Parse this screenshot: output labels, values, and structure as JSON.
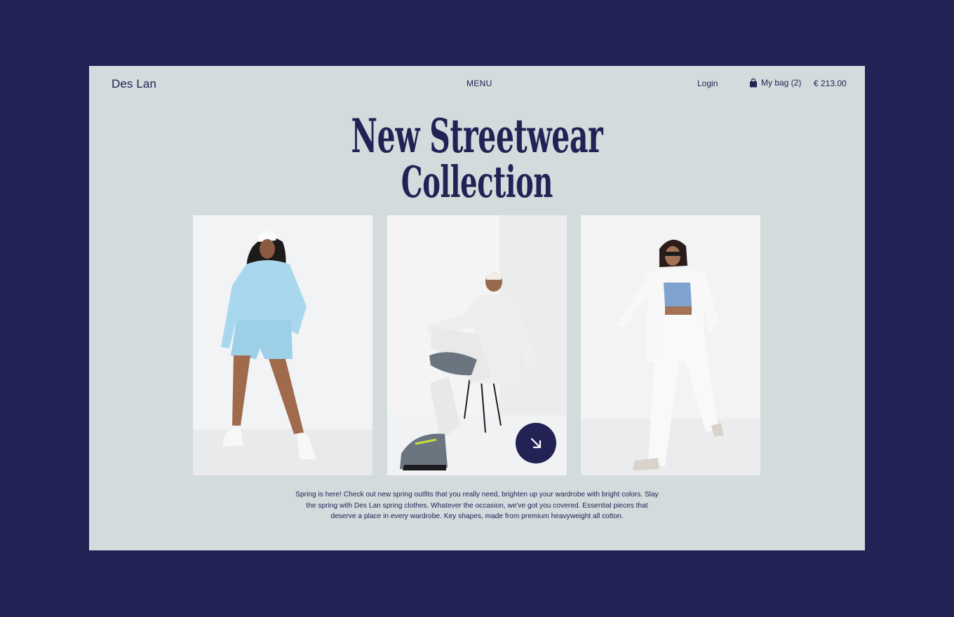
{
  "nav": {
    "brand": "Des Lan",
    "menu_label": "MENU",
    "login_label": "Login",
    "bag_label": "My bag (2)",
    "bag_total": "€ 213.00"
  },
  "hero": {
    "title_line1": "New Streetwear",
    "title_line2": "Collection"
  },
  "gallery": {
    "items": [
      {
        "outfit": "light blue sweatshirt and shorts set"
      },
      {
        "outfit": "white knit cardigan and joggers, seated"
      },
      {
        "outfit": "white blazer and wide-leg trousers with blue crop top"
      }
    ]
  },
  "cta": {
    "icon": "arrow-down-right-icon"
  },
  "description": "Spring is here! Check out new spring outfits that you really need, brighten up your wardrobe with bright colors. Slay the spring with Des Lan spring clothes. Whatever the occasion, we've got you covered. Essential pieces that deserve a place in every wardrobe. Key shapes, made from premium heavyweight all cotton.",
  "colors": {
    "background": "#222255",
    "card": "#d3dbdc",
    "accent": "#222255",
    "photo_bg": "#f0f1f2"
  }
}
